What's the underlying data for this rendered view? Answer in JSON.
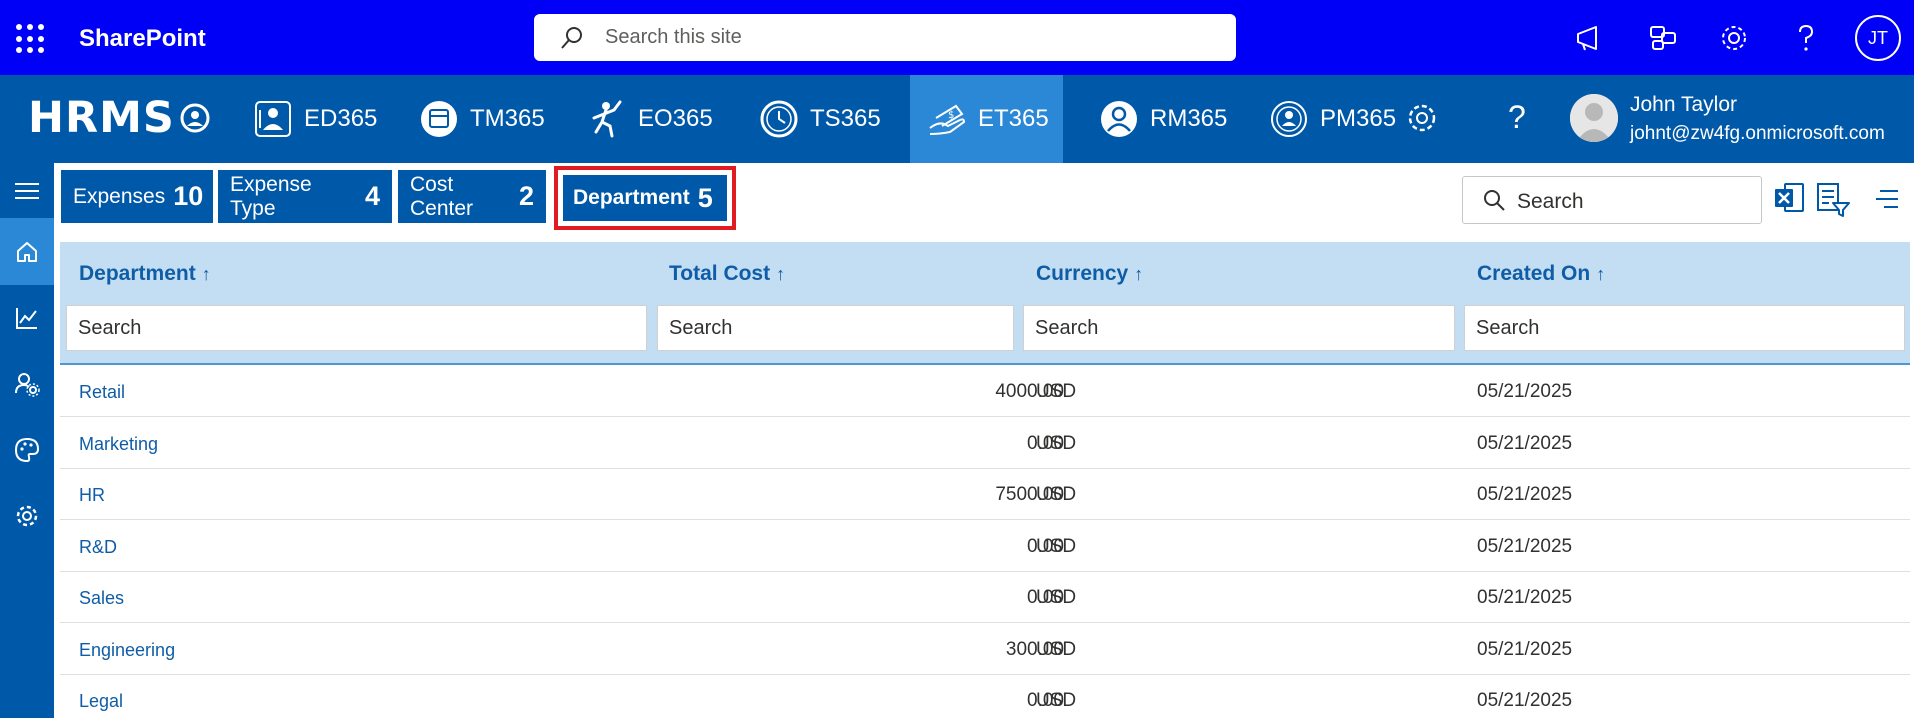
{
  "suite": {
    "brand": "SharePoint",
    "search_placeholder": "Search this site",
    "user_initials": "JT"
  },
  "app": {
    "logo": "HRMS",
    "modules": [
      {
        "label": "ED365",
        "icon": "employee-directory-icon"
      },
      {
        "label": "TM365",
        "icon": "calendar-icon"
      },
      {
        "label": "EO365",
        "icon": "climbing-person-icon"
      },
      {
        "label": "TS365",
        "icon": "clock-icon"
      },
      {
        "label": "ET365",
        "icon": "money-hand-icon",
        "active": true
      },
      {
        "label": "RM365",
        "icon": "user-circle-icon"
      },
      {
        "label": "PM365",
        "icon": "user-badge-icon"
      }
    ],
    "user": {
      "name": "John Taylor",
      "email": "johnt@zw4fg.onmicrosoft.com"
    }
  },
  "rail": {
    "items": [
      "menu-icon",
      "home-icon",
      "chart-icon",
      "user-settings-icon",
      "palette-icon",
      "gear-icon"
    ]
  },
  "tabs": [
    {
      "label": "Expenses",
      "count": "10"
    },
    {
      "label": "Expense Type",
      "count": "4"
    },
    {
      "label": "Cost Center",
      "count": "2"
    },
    {
      "label": "Department",
      "count": "5",
      "selected": true
    }
  ],
  "toolbar": {
    "search_placeholder": "Search"
  },
  "table": {
    "columns": [
      {
        "label": "Department",
        "sort": "↑",
        "search": "Search"
      },
      {
        "label": "Total Cost",
        "sort": "↑",
        "search": "Search"
      },
      {
        "label": "Currency",
        "sort": "↑",
        "search": "Search"
      },
      {
        "label": "Created On",
        "sort": "↑",
        "search": "Search"
      }
    ],
    "rows": [
      {
        "department": "Retail",
        "total_cost": "4000.00",
        "currency": "USD",
        "created_on": "05/21/2025"
      },
      {
        "department": "Marketing",
        "total_cost": "0.00",
        "currency": "USD",
        "created_on": "05/21/2025"
      },
      {
        "department": "HR",
        "total_cost": "7500.00",
        "currency": "USD",
        "created_on": "05/21/2025"
      },
      {
        "department": "R&D",
        "total_cost": "0.00",
        "currency": "USD",
        "created_on": "05/21/2025"
      },
      {
        "department": "Sales",
        "total_cost": "0.00",
        "currency": "USD",
        "created_on": "05/21/2025"
      },
      {
        "department": "Engineering",
        "total_cost": "300.00",
        "currency": "USD",
        "created_on": "05/21/2025"
      },
      {
        "department": "Legal",
        "total_cost": "0.00",
        "currency": "USD",
        "created_on": "05/21/2025"
      }
    ]
  },
  "colors": {
    "suitebar": "#0000f6",
    "appbar": "#0058a8",
    "active_tab": "#2a88d6",
    "header_bg": "#c3ddf3",
    "link": "#0f5da6",
    "highlight": "#e11b22"
  }
}
